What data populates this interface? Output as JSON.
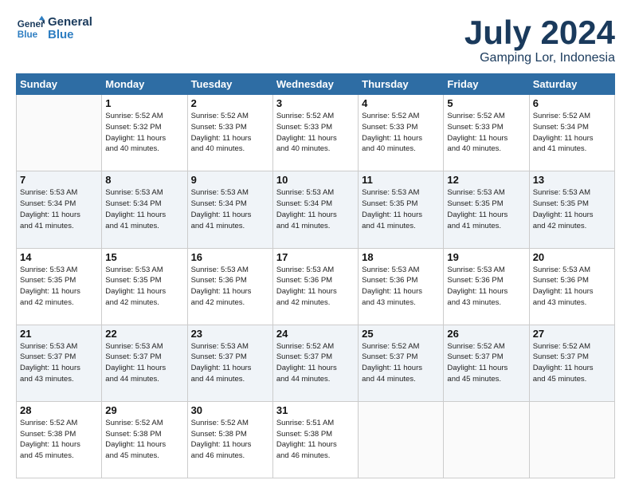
{
  "header": {
    "logo_line1": "General",
    "logo_line2": "Blue",
    "main_title": "July 2024",
    "subtitle": "Gamping Lor, Indonesia"
  },
  "days_of_week": [
    "Sunday",
    "Monday",
    "Tuesday",
    "Wednesday",
    "Thursday",
    "Friday",
    "Saturday"
  ],
  "weeks": [
    [
      {
        "day": "",
        "info": ""
      },
      {
        "day": "1",
        "info": "Sunrise: 5:52 AM\nSunset: 5:32 PM\nDaylight: 11 hours\nand 40 minutes."
      },
      {
        "day": "2",
        "info": "Sunrise: 5:52 AM\nSunset: 5:33 PM\nDaylight: 11 hours\nand 40 minutes."
      },
      {
        "day": "3",
        "info": "Sunrise: 5:52 AM\nSunset: 5:33 PM\nDaylight: 11 hours\nand 40 minutes."
      },
      {
        "day": "4",
        "info": "Sunrise: 5:52 AM\nSunset: 5:33 PM\nDaylight: 11 hours\nand 40 minutes."
      },
      {
        "day": "5",
        "info": "Sunrise: 5:52 AM\nSunset: 5:33 PM\nDaylight: 11 hours\nand 40 minutes."
      },
      {
        "day": "6",
        "info": "Sunrise: 5:52 AM\nSunset: 5:34 PM\nDaylight: 11 hours\nand 41 minutes."
      }
    ],
    [
      {
        "day": "7",
        "info": "Sunrise: 5:53 AM\nSunset: 5:34 PM\nDaylight: 11 hours\nand 41 minutes."
      },
      {
        "day": "8",
        "info": "Sunrise: 5:53 AM\nSunset: 5:34 PM\nDaylight: 11 hours\nand 41 minutes."
      },
      {
        "day": "9",
        "info": "Sunrise: 5:53 AM\nSunset: 5:34 PM\nDaylight: 11 hours\nand 41 minutes."
      },
      {
        "day": "10",
        "info": "Sunrise: 5:53 AM\nSunset: 5:34 PM\nDaylight: 11 hours\nand 41 minutes."
      },
      {
        "day": "11",
        "info": "Sunrise: 5:53 AM\nSunset: 5:35 PM\nDaylight: 11 hours\nand 41 minutes."
      },
      {
        "day": "12",
        "info": "Sunrise: 5:53 AM\nSunset: 5:35 PM\nDaylight: 11 hours\nand 41 minutes."
      },
      {
        "day": "13",
        "info": "Sunrise: 5:53 AM\nSunset: 5:35 PM\nDaylight: 11 hours\nand 42 minutes."
      }
    ],
    [
      {
        "day": "14",
        "info": "Sunrise: 5:53 AM\nSunset: 5:35 PM\nDaylight: 11 hours\nand 42 minutes."
      },
      {
        "day": "15",
        "info": "Sunrise: 5:53 AM\nSunset: 5:35 PM\nDaylight: 11 hours\nand 42 minutes."
      },
      {
        "day": "16",
        "info": "Sunrise: 5:53 AM\nSunset: 5:36 PM\nDaylight: 11 hours\nand 42 minutes."
      },
      {
        "day": "17",
        "info": "Sunrise: 5:53 AM\nSunset: 5:36 PM\nDaylight: 11 hours\nand 42 minutes."
      },
      {
        "day": "18",
        "info": "Sunrise: 5:53 AM\nSunset: 5:36 PM\nDaylight: 11 hours\nand 43 minutes."
      },
      {
        "day": "19",
        "info": "Sunrise: 5:53 AM\nSunset: 5:36 PM\nDaylight: 11 hours\nand 43 minutes."
      },
      {
        "day": "20",
        "info": "Sunrise: 5:53 AM\nSunset: 5:36 PM\nDaylight: 11 hours\nand 43 minutes."
      }
    ],
    [
      {
        "day": "21",
        "info": "Sunrise: 5:53 AM\nSunset: 5:37 PM\nDaylight: 11 hours\nand 43 minutes."
      },
      {
        "day": "22",
        "info": "Sunrise: 5:53 AM\nSunset: 5:37 PM\nDaylight: 11 hours\nand 44 minutes."
      },
      {
        "day": "23",
        "info": "Sunrise: 5:53 AM\nSunset: 5:37 PM\nDaylight: 11 hours\nand 44 minutes."
      },
      {
        "day": "24",
        "info": "Sunrise: 5:52 AM\nSunset: 5:37 PM\nDaylight: 11 hours\nand 44 minutes."
      },
      {
        "day": "25",
        "info": "Sunrise: 5:52 AM\nSunset: 5:37 PM\nDaylight: 11 hours\nand 44 minutes."
      },
      {
        "day": "26",
        "info": "Sunrise: 5:52 AM\nSunset: 5:37 PM\nDaylight: 11 hours\nand 45 minutes."
      },
      {
        "day": "27",
        "info": "Sunrise: 5:52 AM\nSunset: 5:37 PM\nDaylight: 11 hours\nand 45 minutes."
      }
    ],
    [
      {
        "day": "28",
        "info": "Sunrise: 5:52 AM\nSunset: 5:38 PM\nDaylight: 11 hours\nand 45 minutes."
      },
      {
        "day": "29",
        "info": "Sunrise: 5:52 AM\nSunset: 5:38 PM\nDaylight: 11 hours\nand 45 minutes."
      },
      {
        "day": "30",
        "info": "Sunrise: 5:52 AM\nSunset: 5:38 PM\nDaylight: 11 hours\nand 46 minutes."
      },
      {
        "day": "31",
        "info": "Sunrise: 5:51 AM\nSunset: 5:38 PM\nDaylight: 11 hours\nand 46 minutes."
      },
      {
        "day": "",
        "info": ""
      },
      {
        "day": "",
        "info": ""
      },
      {
        "day": "",
        "info": ""
      }
    ]
  ]
}
